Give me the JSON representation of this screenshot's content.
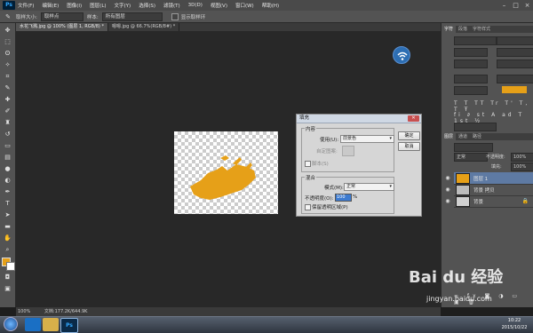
{
  "app": {
    "logo": "Ps"
  },
  "menu": [
    "文件(F)",
    "编辑(E)",
    "图像(I)",
    "图层(L)",
    "文字(Y)",
    "选择(S)",
    "滤镜(T)",
    "3D(D)",
    "视图(V)",
    "窗口(W)",
    "帮助(H)"
  ],
  "options_bar": {
    "size_label": "取样大小:",
    "size_value": "取样点",
    "sample_label": "样本:",
    "sample_value": "所有图层",
    "ring_label": "显示取样环"
  },
  "tabs": [
    {
      "label": "水花飞溅.jpg @ 100% (图层 1, RGB/8) *",
      "active": true
    },
    {
      "label": "嗯嗯.jpg @ 66.7%(RGB/8#) *",
      "active": false
    }
  ],
  "dialog": {
    "title": "填充",
    "content_group": "内容",
    "use_label": "使用(U):",
    "use_value": "前景色",
    "custom_pattern_label": "自定图案:",
    "script_label": "脚本(S)",
    "blend_group": "混合",
    "mode_label": "模式(M):",
    "mode_value": "正常",
    "opacity_label": "不透明度(O):",
    "opacity_value": "100",
    "opacity_unit": "%",
    "preserve_label": "保留透明区域(P)",
    "ok": "确定",
    "cancel": "取消"
  },
  "panels": {
    "top_tabs": [
      "字符",
      "段落",
      "字符样式"
    ],
    "layers_tabs": [
      "图层",
      "通道",
      "路径"
    ],
    "blend_mode": "正常",
    "opacity_label": "不透明度:",
    "opacity_value": "100%",
    "fill_label": "填充:",
    "fill_value": "100%",
    "layers": [
      {
        "name": "图层 1",
        "selected": true
      },
      {
        "name": "背景 拷贝",
        "selected": false
      },
      {
        "name": "背景",
        "selected": false
      }
    ],
    "fg_color": "#e6a018"
  },
  "status": {
    "zoom": "100%",
    "doc": "文档:177.2K/644.9K"
  },
  "taskbar": {
    "time": "10:22",
    "date": "2015/10/22"
  },
  "watermark": {
    "site": "jingyan.baidu.com",
    "brand": "Bai du 经验"
  }
}
